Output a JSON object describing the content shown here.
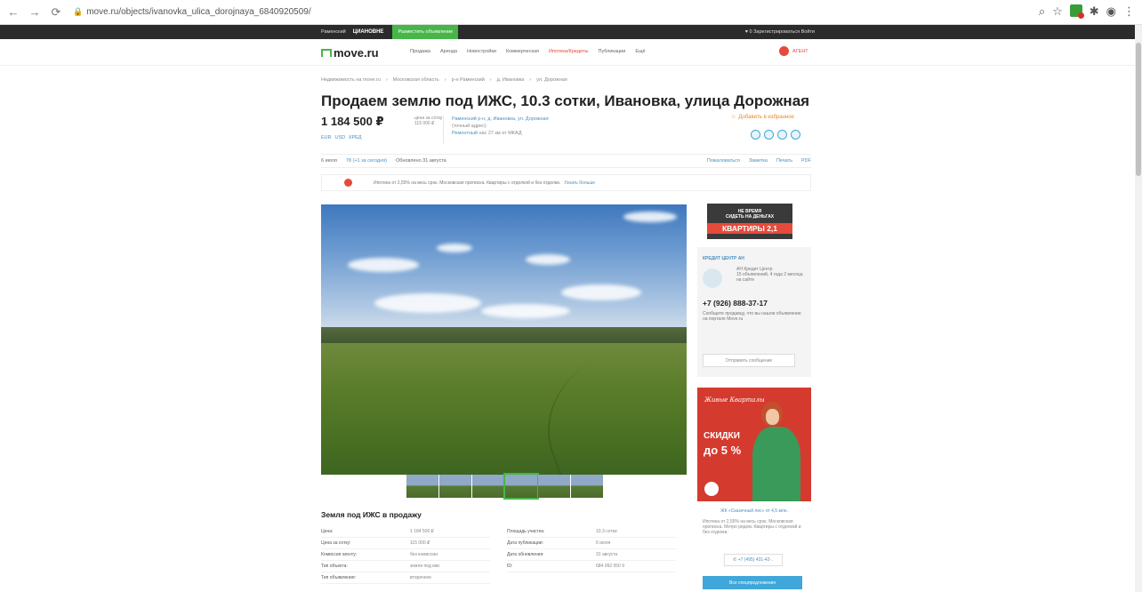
{
  "browser": {
    "url": "move.ru/objects/ivanovka_ulica_dorojnaya_6840920509/"
  },
  "topbar": {
    "region": "Раменский",
    "brand": "ЦИАНОВНЕ",
    "post_ad": "Разместить объявление",
    "right": "♥ 0  Зарегистрироваться  Войти"
  },
  "header": {
    "logo": "move.ru",
    "nav": [
      "Продажа",
      "Аренда",
      "Новостройки",
      "Коммерческая",
      "Ипотека/Кредиты",
      "Публикации",
      "Ещё"
    ],
    "user": "АГЕНТ"
  },
  "breadcrumbs": [
    "Недвижимость на move.ru",
    "Московская область",
    "р-н Раменский",
    "д. Ивановка",
    "ул. Дорожная"
  ],
  "listing": {
    "title": "Продаем землю под ИЖС, 10.3 сотки, Ивановка, улица Дорожная",
    "price": "1 184 500 ₽",
    "price_per_label": "цена за сотку",
    "price_per_value": "115 000 ₽",
    "currency_links": [
      "EUR",
      "USD",
      "КРЕД"
    ],
    "address_line1": "Раменский р-н, д. Ивановка, ул. Дорожная",
    "address_grey": "(точный адрес)",
    "address_line2": "Ремонтный",
    "address_distance": "нас 27 км от МКАД",
    "favorite": "Добавить в избранное"
  },
  "meta": {
    "views": "6 июля",
    "today": "78 (+1 за сегодня)",
    "updated": "Обновлено 31 августа",
    "complain": "Пожаловаться",
    "note": "Заметка",
    "print": "Печать",
    "pdf": "PDF"
  },
  "strip": {
    "text": "Ипотека от 2,55% на весь срок. Московская прописка. Квартиры с отделкой и без отделки.",
    "link": "Узнать больше"
  },
  "details": {
    "title": "Земля под ИЖС в продажу",
    "left": [
      {
        "k": "Цена:",
        "v": "1 184 500 ₽"
      },
      {
        "k": "Цена за сотку:",
        "v": "115 000 ₽"
      },
      {
        "k": "Комиссия агенту:",
        "v": "без комиссии"
      },
      {
        "k": "Тип объекта:",
        "v": "земля под ижс"
      },
      {
        "k": "Тип объявления:",
        "v": "вторичное"
      }
    ],
    "right": [
      {
        "k": "Площадь участка:",
        "v": "10.3 сотки"
      },
      {
        "k": "Дата публикации:",
        "v": "6 июля"
      },
      {
        "k": "Дата обновления:",
        "v": "31 августа"
      },
      {
        "k": "ID:",
        "v": "684 092 050 9"
      }
    ]
  },
  "sidebar": {
    "promo1_line1": "НЕ ВРЕМЯ",
    "promo1_line2": "СИДЕТЬ НА ДЕНЬГАХ",
    "promo1_big": "КВАРТИРЫ 2,1",
    "agent_name": "КРЕДИТ ЦЕНТР АН",
    "agent_company": "АН Кредит Центр",
    "agent_company_sub": "15 объявлений, 4 года 2 месяца на сайте",
    "phone": "+7 (926) 888-37-17",
    "phone_note": "Сообщите продавцу, что вы нашли объявление на портале Move.ru",
    "send_btn": "Отправить сообщение",
    "promo2_brand": "Живые Кварталы",
    "promo2_discount": "СКИДКИ",
    "promo2_pct": "до 5 %",
    "promo2_link": "ЖК «Сказочный лес» от 4,5 млн.",
    "promo2_text": "Ипотека от 2,55% на весь срок. Московская прописка. Метро рядом. Квартиры с отделкой и без отделки.",
    "promo2_phone": "+7 (495) 431-42-..",
    "promo2_btn": "Все спецпредложения"
  }
}
